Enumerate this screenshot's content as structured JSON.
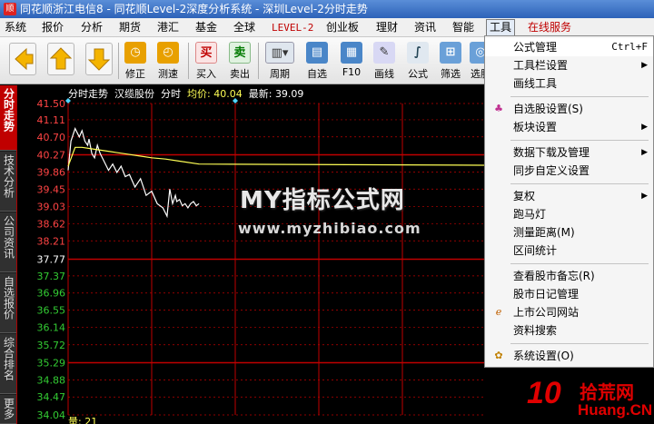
{
  "title": "同花顺浙江电信8 - 同花顺Level-2深度分析系统 - 深圳Level-2分时走势",
  "menu": [
    "系统",
    "报价",
    "分析",
    "期货",
    "港汇",
    "基金",
    "全球",
    "LEVEL-2",
    "创业板",
    "理财",
    "资讯",
    "智能",
    "工具",
    "在线服务"
  ],
  "toolbar": {
    "buttons": [
      "修正",
      "测速",
      "买入",
      "卖出",
      "周期",
      "自选",
      "F10",
      "画线",
      "公式",
      "筛选",
      "选股"
    ]
  },
  "left_tabs": [
    "分时走势",
    "技术分析",
    "公司资讯",
    "自选报价",
    "综合排名",
    "更多"
  ],
  "chart": {
    "header_title": "分时走势",
    "stock_name": "汉缆股份",
    "label_time": "分时",
    "avg_label": "均价:",
    "avg_value": "40.04",
    "latest_label": "最新:",
    "latest_value": "39.09",
    "bottom_label": "量: 21"
  },
  "chart_data": {
    "type": "line",
    "y_ticks": [
      "41.50",
      "41.11",
      "40.70",
      "40.27",
      "39.86",
      "39.45",
      "39.03",
      "38.62",
      "38.21",
      "37.77",
      "37.37",
      "36.96",
      "36.55",
      "36.14",
      "35.72",
      "35.29",
      "34.88",
      "34.47",
      "34.04"
    ],
    "ylim": [
      34.04,
      41.5
    ],
    "reference_price": 37.77,
    "series": [
      {
        "name": "最新",
        "color": "#ffffff",
        "x": [
          0,
          2,
          5,
          8,
          10,
          12,
          14,
          15,
          17,
          19,
          21,
          23,
          26,
          29,
          32,
          35,
          38,
          41,
          44,
          48,
          52,
          56,
          60,
          64,
          68,
          71,
          73,
          75,
          76,
          77,
          78,
          80,
          82,
          84,
          86,
          88,
          90,
          92,
          94
        ],
        "y": [
          39.9,
          40.6,
          40.9,
          40.7,
          40.85,
          40.6,
          40.5,
          40.65,
          40.3,
          40.2,
          40.5,
          40.3,
          40.1,
          39.9,
          40.05,
          39.85,
          40.0,
          39.75,
          39.8,
          39.5,
          39.7,
          39.3,
          39.4,
          39.1,
          39.0,
          38.8,
          39.45,
          39.1,
          39.2,
          39.3,
          39.15,
          39.2,
          39.05,
          39.1,
          39.0,
          39.1,
          39.15,
          39.05,
          39.1
        ]
      },
      {
        "name": "均价",
        "color": "#ffff55",
        "x": [
          0,
          5,
          10,
          20,
          30,
          40,
          50,
          60,
          70,
          80,
          94
        ],
        "y": [
          40.0,
          40.45,
          40.45,
          40.4,
          40.35,
          40.3,
          40.25,
          40.2,
          40.17,
          40.12,
          40.05
        ]
      }
    ]
  },
  "dropdown": {
    "items": [
      {
        "label": "公式管理",
        "shortcut": "Ctrl+F"
      },
      {
        "label": "工具栏设置",
        "submenu": true
      },
      {
        "label": "画线工具"
      },
      {
        "label": "自选股设置(S)",
        "icon": "self-stock-icon"
      },
      {
        "label": "板块设置",
        "submenu": true
      },
      {
        "label": "数据下载及管理",
        "submenu": true
      },
      {
        "label": "同步自定义设置"
      },
      {
        "label": "复权",
        "submenu": true
      },
      {
        "label": "跑马灯"
      },
      {
        "label": "测量距离(M)"
      },
      {
        "label": "区间统计"
      },
      {
        "label": "查看股市备忘(R)"
      },
      {
        "label": "股市日记管理"
      },
      {
        "label": "上市公司网站",
        "icon": "website-icon"
      },
      {
        "label": "资料搜索"
      },
      {
        "label": "系统设置(O)",
        "icon": "settings-icon"
      }
    ]
  },
  "watermark": {
    "line1": "MY指标公式网",
    "line2": "www.myzhibiao.com",
    "logo_num": "10",
    "logo_text": "拾荒网",
    "logo_url": "Huang.CN"
  },
  "colors": {
    "chart_bg": "#000000",
    "grid_red": "#c00000",
    "price_line": "#ffffff",
    "avg_line": "#ffff55",
    "tick_up": "#ff4444",
    "tick_down": "#33cc33"
  }
}
